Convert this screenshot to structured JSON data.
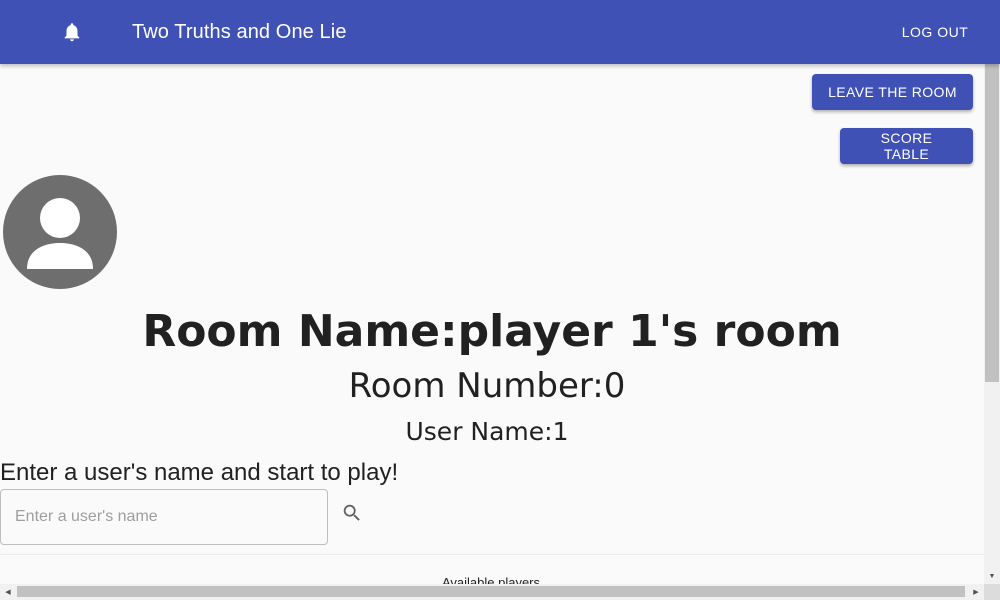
{
  "appbar": {
    "title": "Two Truths and One Lie",
    "logout_label": "LOG OUT",
    "bell_icon": "bell-icon"
  },
  "actions": {
    "leave_room_label": "LEAVE THE ROOM",
    "score_table_label": "SCORE TABLE"
  },
  "room": {
    "avatar_icon": "person-icon",
    "name_heading": "Room Name:player 1's room",
    "number_text": "Room Number:0",
    "user_text": "User Name:1"
  },
  "search": {
    "prompt": "Enter a user's name and start to play!",
    "placeholder": "Enter a user's name",
    "value": "",
    "icon": "search-icon"
  },
  "players": {
    "heading": "Available players"
  },
  "colors": {
    "primary": "#3f51b5",
    "background": "#fafafa",
    "avatar": "#6e6e6e"
  }
}
